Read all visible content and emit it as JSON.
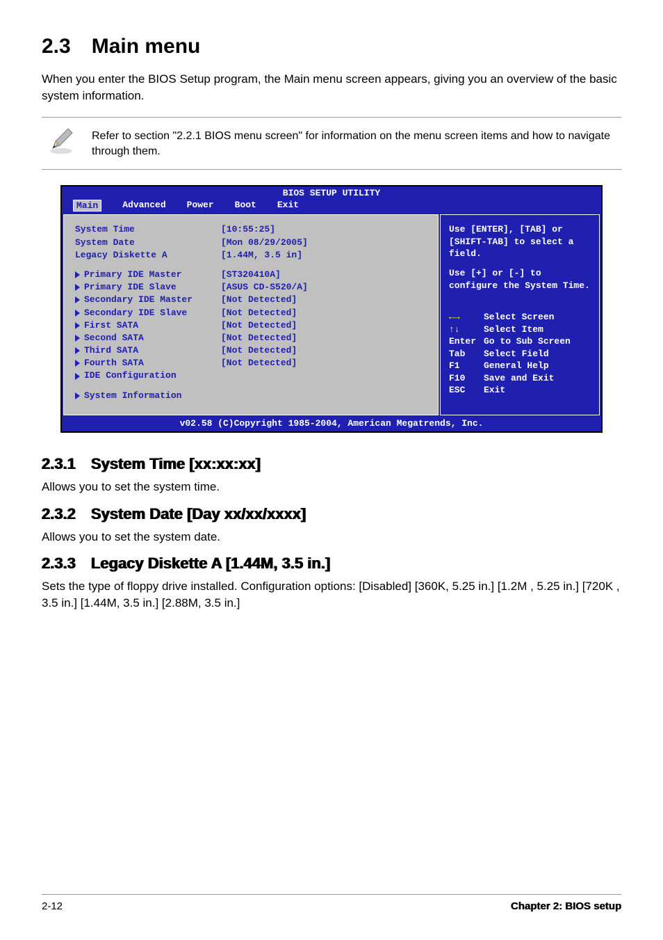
{
  "heading": "2.3 Main menu",
  "intro": "When you enter the BIOS Setup program, the Main menu screen appears, giving you an overview of the basic system information.",
  "note": "Refer to section \"2.2.1  BIOS menu screen\" for information on the menu screen items and how to navigate through them.",
  "bios": {
    "title": "BIOS SETUP UTILITY",
    "tabs": [
      "Main",
      "Advanced",
      "Power",
      "Boot",
      "Exit"
    ],
    "rows": [
      {
        "label": "System Time",
        "value": "[10:55:25]",
        "tri": false
      },
      {
        "label": "System Date",
        "value": "[Mon 08/29/2005]",
        "tri": false
      },
      {
        "label": "Legacy Diskette A",
        "value": "[1.44M, 3.5 in]",
        "tri": false
      }
    ],
    "rows2": [
      {
        "label": "Primary IDE Master",
        "value": "[ST320410A]",
        "tri": true
      },
      {
        "label": "Primary IDE Slave",
        "value": "[ASUS CD-S520/A]",
        "tri": true
      },
      {
        "label": "Secondary IDE Master",
        "value": "[Not Detected]",
        "tri": true
      },
      {
        "label": "Secondary IDE Slave",
        "value": "[Not Detected]",
        "tri": true
      },
      {
        "label": "First SATA",
        "value": "[Not Detected]",
        "tri": true
      },
      {
        "label": "Second SATA",
        "value": "[Not Detected]",
        "tri": true
      },
      {
        "label": "Third SATA",
        "value": "[Not Detected]",
        "tri": true
      },
      {
        "label": "Fourth SATA",
        "value": "[Not Detected]",
        "tri": true
      },
      {
        "label": "IDE Configuration",
        "value": "",
        "tri": true
      }
    ],
    "rows3": [
      {
        "label": "System Information",
        "value": "",
        "tri": true
      }
    ],
    "help1": "Use [ENTER], [TAB] or [SHIFT-TAB] to select a field.",
    "help2": "Use [+] or [-] to configure the System Time.",
    "keys": [
      {
        "k": "←→",
        "d": "Select Screen",
        "cls": "arrows-h"
      },
      {
        "k": "↑↓",
        "d": "Select Item",
        "cls": "arrows-v"
      },
      {
        "k": "Enter",
        "d": "Go to Sub Screen",
        "cls": ""
      },
      {
        "k": "Tab",
        "d": "Select Field",
        "cls": ""
      },
      {
        "k": "F1",
        "d": "General Help",
        "cls": ""
      },
      {
        "k": "F10",
        "d": "Save and Exit",
        "cls": ""
      },
      {
        "k": "ESC",
        "d": "Exit",
        "cls": ""
      }
    ],
    "footer": "v02.58 (C)Copyright 1985-2004, American Megatrends, Inc."
  },
  "sections": [
    {
      "h": "2.3.1 System Time [xx:xx:xx]",
      "t": "Allows you to set the system time."
    },
    {
      "h": "2.3.2 System Date [Day xx/xx/xxxx]",
      "t": "Allows you to set the system date."
    },
    {
      "h": "2.3.3 Legacy Diskette A [1.44M, 3.5 in.]",
      "t": "Sets the type of floppy drive installed. Configuration options: [Disabled] [360K, 5.25 in.] [1.2M , 5.25 in.] [720K , 3.5 in.] [1.44M, 3.5 in.] [2.88M, 3.5 in.]"
    }
  ],
  "footer": {
    "left": "2-12",
    "right": "Chapter 2: BIOS setup"
  }
}
